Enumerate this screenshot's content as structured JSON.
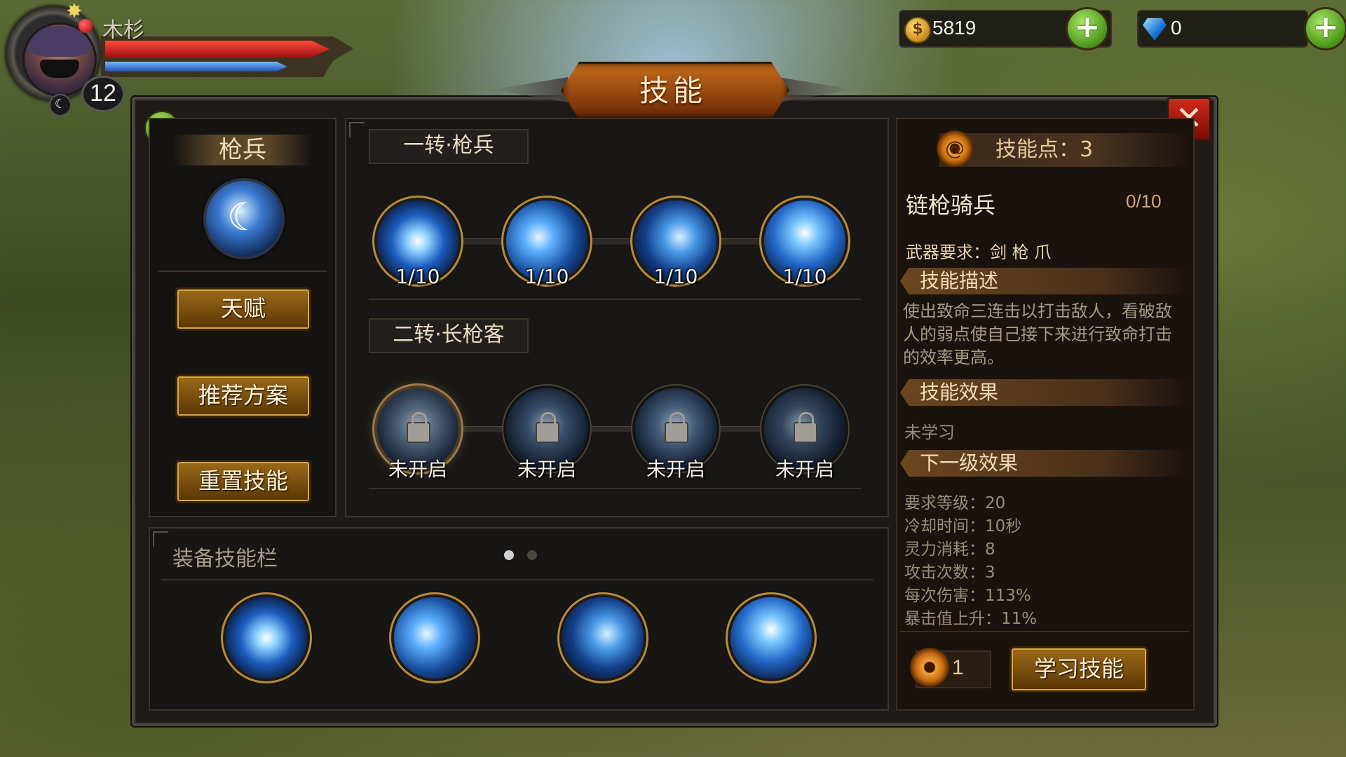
{
  "player": {
    "name": "木杉",
    "level": "12"
  },
  "currency": {
    "gold": {
      "value": "5819",
      "icon": "gold-coin-icon"
    },
    "diamond": {
      "value": "0",
      "icon": "diamond-icon"
    }
  },
  "window": {
    "title": "技能",
    "close": "✕",
    "help": "?"
  },
  "left": {
    "class_name": "枪兵",
    "class_icon": "crescent-icon",
    "buttons": {
      "talent": "天赋",
      "recommend": "推荐方案",
      "reset": "重置技能"
    }
  },
  "tree": {
    "tier1": {
      "label": "一转·枪兵",
      "nodes": [
        {
          "status": "1/10",
          "icon": "vortex-eye-icon"
        },
        {
          "status": "1/10",
          "icon": "spear-thrust-icon"
        },
        {
          "status": "1/10",
          "icon": "claw-strike-icon"
        },
        {
          "status": "1/10",
          "icon": "blade-wave-icon"
        }
      ]
    },
    "tier2": {
      "label": "二转·长枪客",
      "nodes": [
        {
          "status": "未开启",
          "icon": "locked-skill-icon"
        },
        {
          "status": "未开启",
          "icon": "locked-skill-icon"
        },
        {
          "status": "未开启",
          "icon": "locked-skill-icon"
        },
        {
          "status": "未开启",
          "icon": "locked-skill-icon"
        }
      ]
    }
  },
  "equip": {
    "title": "装备技能栏",
    "page_count": 2,
    "active_page": 1,
    "slots": [
      "vortex-eye-icon",
      "spear-thrust-icon",
      "claw-strike-icon",
      "blade-wave-icon"
    ]
  },
  "detail": {
    "skill_points": "技能点：3",
    "skill_name": "链枪骑兵",
    "skill_level": "0/10",
    "weapon_req": "武器要求：剑 枪 爪",
    "desc_title": "技能描述",
    "description": "使出致命三连击以打击敌人，看破敌人的弱点使自己接下来进行致命打击的效率更高。",
    "effect_title": "技能效果",
    "effect": "未学习",
    "next_title": "下一级效果",
    "next_stats": [
      "要求等级：20",
      "冷却时间：10秒",
      "灵力消耗：8",
      "攻击次数：3",
      "每次伤害：113%",
      "暴击值上升：11%"
    ],
    "cost": "1",
    "learn_button": "学习技能"
  },
  "colors": {
    "accent_gold": "#d9a545",
    "title_orange": "#c46d1a",
    "close_red": "#d22a1a",
    "plus_green": "#4f9a1c"
  }
}
